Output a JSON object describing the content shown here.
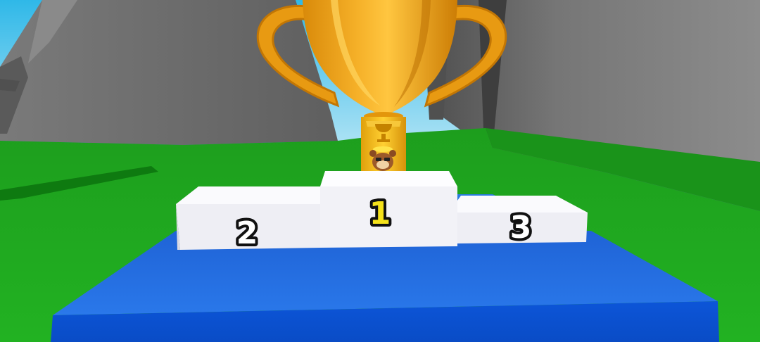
{
  "scene": {
    "podium": {
      "first_place_label": "1",
      "second_place_label": "2",
      "third_place_label": "3"
    },
    "icons": {
      "trophy": "trophy-icon",
      "character": "bear-character-icon"
    },
    "colors": {
      "sky": "#8fd6f0",
      "grass": "#1eaa1e",
      "grass_dark": "#128412",
      "rock": "#6f6f6f",
      "podium": "#f2f2f6",
      "stage": "#1f63d6",
      "trophy": "#f2a51a",
      "first_place_number": "#f5e21a",
      "other_place_number": "#ffffff"
    }
  }
}
